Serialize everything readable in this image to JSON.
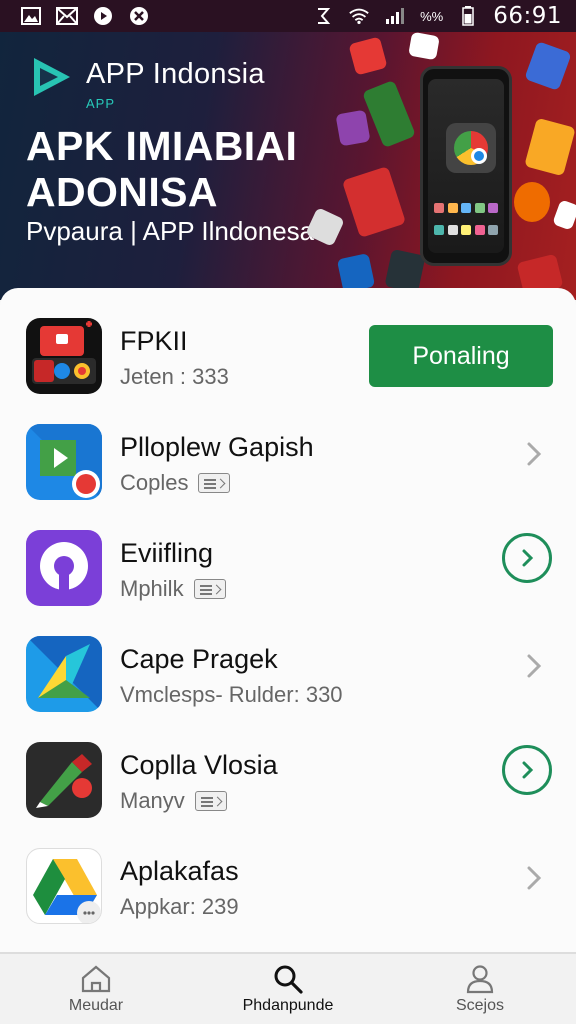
{
  "status_bar": {
    "time": "66:91",
    "battery_text": "%%",
    "left_icons": [
      "gallery-icon",
      "mail-icon",
      "play-icon",
      "settings-icon"
    ],
    "right_icons": [
      "alarm-icon",
      "wifi-icon",
      "signal-icon",
      "battery-icon"
    ]
  },
  "banner": {
    "brand": "APP Indonsia",
    "brand_sub": "APP",
    "title": "APK IMIABIAI ADONISA",
    "tagline": "Pvpaura | APP Ilndonesa",
    "accent_color": "#27c9b9"
  },
  "apps": [
    {
      "name": "FPKII",
      "subtitle": "Jeten : 333",
      "action": "button",
      "action_label": "Ponaling",
      "show_badge": false
    },
    {
      "name": "Plloplew Gapish",
      "subtitle": "Coples",
      "action": "chevron",
      "show_badge": true
    },
    {
      "name": "Eviifling",
      "subtitle": "Mphilk",
      "action": "chevron-circle",
      "show_badge": true
    },
    {
      "name": "Cape Pragek",
      "subtitle": "Vmclesps- Rulder: 330",
      "action": "chevron",
      "show_badge": false
    },
    {
      "name": "Coplla Vlosia",
      "subtitle": "Manyv",
      "action": "chevron-circle",
      "show_badge": true
    },
    {
      "name": "Aplakafas",
      "subtitle": "Appkar: 239",
      "action": "chevron",
      "show_badge": false
    }
  ],
  "bottom_nav": [
    {
      "label": "Meudar",
      "icon": "home-icon",
      "active": false
    },
    {
      "label": "Phdanpunde",
      "icon": "search-icon",
      "active": true
    },
    {
      "label": "Scejos",
      "icon": "profile-icon",
      "active": false
    }
  ],
  "colors": {
    "primary_button": "#1e8e45",
    "circle_accent": "#1e8e5a"
  }
}
